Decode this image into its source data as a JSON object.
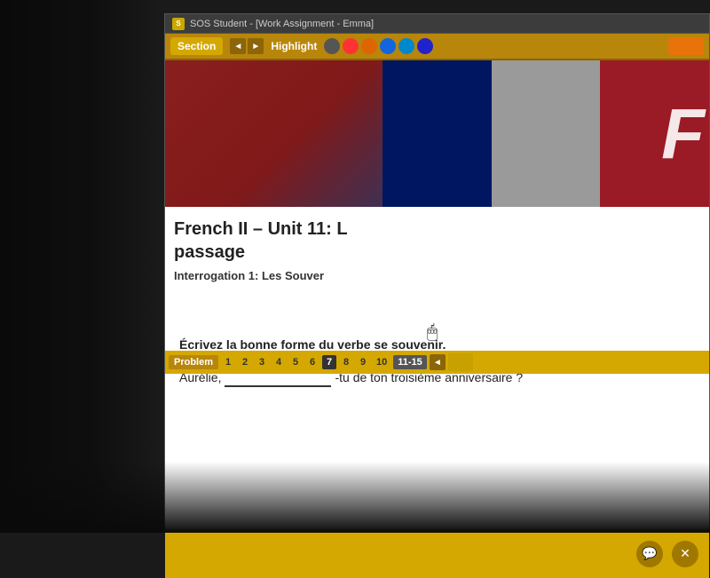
{
  "window": {
    "title": "SOS Student - [Work Assignment - Emma]"
  },
  "toolbar": {
    "section_label": "Section",
    "highlight_label": "Highlight",
    "nav_prev": "◄",
    "nav_next": "►",
    "colors": [
      "#666666",
      "#ff4444",
      "#ff8800",
      "#2288ff",
      "#00aa44"
    ],
    "color_names": [
      "gray",
      "red",
      "orange",
      "blue",
      "green"
    ]
  },
  "header_image": {
    "f_letter": "F"
  },
  "unit": {
    "title": "French II – Unit 11: L",
    "subtitle_suffix": "passage",
    "interrogation": "Interrogation 1: Les Souver"
  },
  "problem_bar": {
    "label": "Problem",
    "numbers": [
      "1",
      "2",
      "3",
      "4",
      "5",
      "6",
      "7",
      "8",
      "9",
      "10"
    ],
    "active_num": "7",
    "range_label": "11-15",
    "nav_prev": "◄",
    "nav_next_label": ""
  },
  "exercise": {
    "instruction": "Écrivez la bonne forme du verbe se souvenir.",
    "sentence_start": "Aurélie,",
    "sentence_end": "-tu de ton troisième anniversaire ?"
  },
  "bottom_bar": {
    "chat_icon": "💬",
    "close_icon": "✕"
  }
}
